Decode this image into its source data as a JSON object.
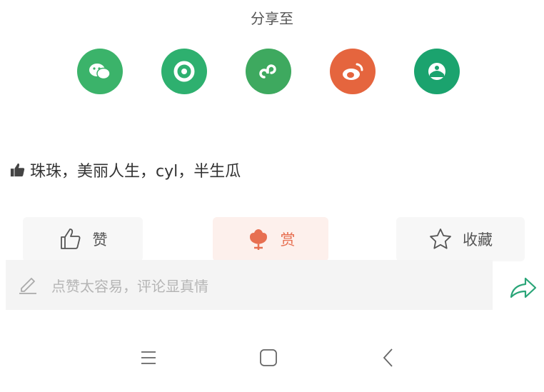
{
  "share": {
    "title": "分享至",
    "targets": [
      {
        "icon": "wechat-icon",
        "color": "#3bb36a"
      },
      {
        "icon": "moments-icon",
        "color": "#2eb06f"
      },
      {
        "icon": "mini-program-icon",
        "color": "#3ea95f"
      },
      {
        "icon": "weibo-icon",
        "color": "#e5653e"
      },
      {
        "icon": "qzone-icon",
        "color": "#1ba36e"
      }
    ]
  },
  "likes": {
    "icon": "thumbs-up-icon",
    "names": "珠珠，美丽人生，cyl，半生瓜"
  },
  "actions": {
    "like_label": "赞",
    "reward_label": "赏",
    "favorite_label": "收藏"
  },
  "comment": {
    "placeholder": "点赞太容易，评论显真情"
  },
  "colors": {
    "accent_green": "#2aa578",
    "reward_orange": "#e76f51"
  }
}
